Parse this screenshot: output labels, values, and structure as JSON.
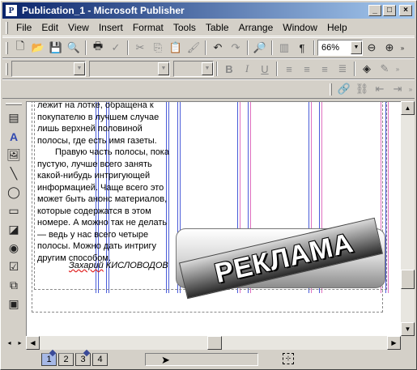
{
  "window": {
    "title": "Publication_1 - Microsoft Publisher",
    "app_icon": "P",
    "controls": {
      "minimize": "_",
      "maximize": "□",
      "close": "×"
    }
  },
  "menu": [
    {
      "label": "File"
    },
    {
      "label": "Edit"
    },
    {
      "label": "View"
    },
    {
      "label": "Insert"
    },
    {
      "label": "Format"
    },
    {
      "label": "Tools"
    },
    {
      "label": "Table"
    },
    {
      "label": "Arrange"
    },
    {
      "label": "Window"
    },
    {
      "label": "Help"
    }
  ],
  "standard_toolbar": {
    "zoom": "66%"
  },
  "article": {
    "para1": "лежит на лотке, обращена к покупателю в лучшем случае лишь верхней половиной полосы, где есть имя газеты.",
    "para2": "Правую часть полосы, пока пустую, лучше всего занять какой-нибудь интригующей информацией. Чаще всего это может быть анонс материалов, которые содержатся в этом номере. А можно так не делать — ведь у нас всего четыре полосы. Можно дать интригу другим способом.",
    "author_first": "Захарий",
    "author_last": "КИСЛОВОДОВ"
  },
  "ad": {
    "text": "РЕКЛАМА"
  },
  "pages": [
    {
      "label": "1",
      "active": true
    },
    {
      "label": "2",
      "active": false
    },
    {
      "label": "3",
      "active": false
    },
    {
      "label": "4",
      "active": false
    }
  ],
  "colors": {
    "titlebar_start": "#0a246a",
    "titlebar_end": "#a6caf0",
    "guide_blue": "#4a5cd8",
    "guide_pink": "#e070c0"
  }
}
